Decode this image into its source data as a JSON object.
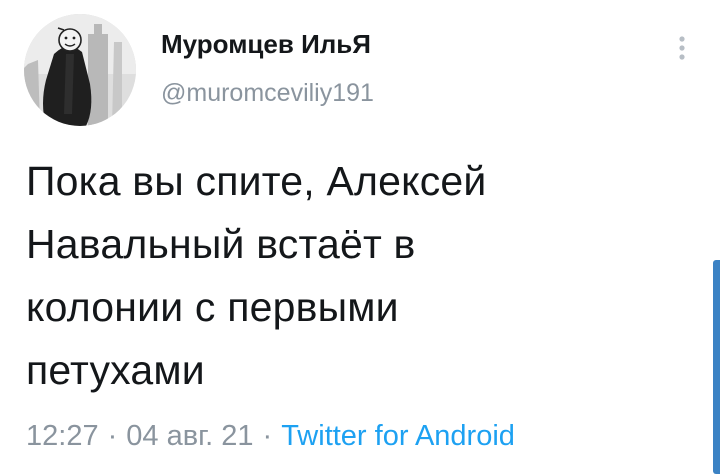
{
  "author": {
    "display_name": "Муромцев ИльЯ",
    "handle": "@muromceviliy191"
  },
  "tweet": {
    "lines": [
      "Пока вы спите, Алексей",
      "Навальный встаёт в",
      "колонии с первыми",
      "петухами"
    ]
  },
  "meta": {
    "time": "12:27",
    "date": "04 авг. 21",
    "separator": "·",
    "source": "Twitter for Android"
  },
  "icons": {
    "more": "vertical-dots-icon",
    "avatar": "avatar-image"
  },
  "colors": {
    "link": "#1da1f2",
    "muted": "#8a949e",
    "text": "#14171a",
    "scroll": "#3b82c4"
  }
}
